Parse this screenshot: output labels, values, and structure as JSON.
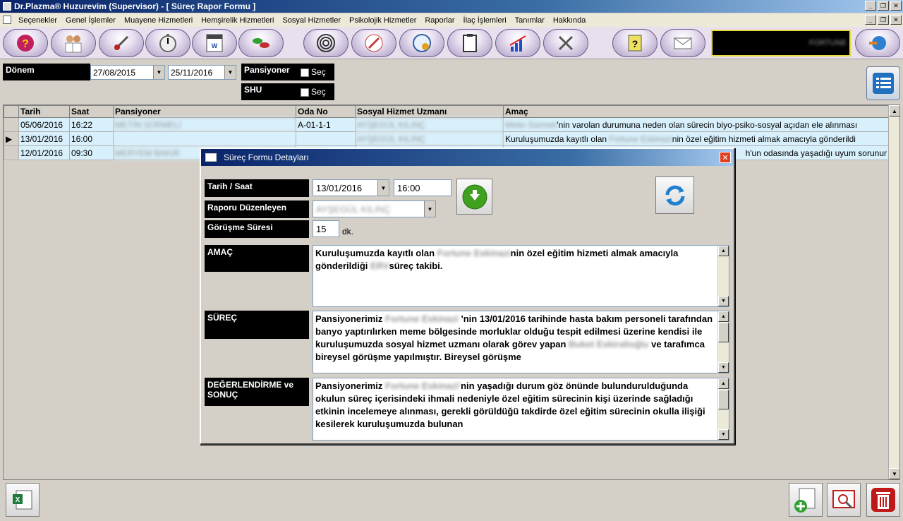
{
  "window": {
    "title": "Dr.Plazma® Huzurevim (Supervisor) - [ Süreç Rapor Formu ]"
  },
  "menu": [
    "Seçenekler",
    "Genel İşlemler",
    "Muayene Hizmetleri",
    "Hemşirelik Hizmetleri",
    "Sosyal Hizmetler",
    "Psikolojik Hizmetler",
    "Raporlar",
    "İlaç İşlemleri",
    "Tanımlar",
    "Hakkında"
  ],
  "toolbar": {
    "icons": [
      "head-help-icon",
      "doctors-icon",
      "nurse-tools-icon",
      "stopwatch-icon",
      "doc-word-icon",
      "pills-icon",
      "spiral-icon",
      "pen-icon",
      "clock-refresh-icon",
      "clipboard-icon",
      "chart-icon",
      "tools-icon",
      "help-note-icon",
      "mail-icon",
      "globe-icon"
    ],
    "brand": "FORTUNE"
  },
  "filters": {
    "period_label": "Dönem",
    "date_from": "27/08/2015",
    "date_to": "25/11/2016",
    "resident_label": "Pansiyoner",
    "resident_check": "Seç",
    "shu_label": "SHU",
    "shu_check": "Seç"
  },
  "grid": {
    "columns": [
      "Tarih",
      "Saat",
      "Pansiyoner",
      "Oda No",
      "Sosyal Hizmet Uzmanı",
      "Amaç"
    ],
    "rows": [
      {
        "date": "05/06/2016",
        "time": "16:22",
        "resident": "METİN SÜRMELİ",
        "room": "A-01-1-1",
        "expert": "AYŞEGÜL KILINÇ",
        "purpose_blur": "Metin Sürmeli",
        "purpose": "'nin varolan durumuna neden olan sürecin biyo-psiko-sosyal açıdan ele alınması"
      },
      {
        "date": "13/01/2016",
        "time": "16:00",
        "resident": "",
        "room": "",
        "expert": "AYŞEGÜL KILINÇ",
        "purpose_pre": "Kuruluşumuzda kayıtlı olan ",
        "purpose_blur": "Fortune Eskinazi",
        "purpose": "nin özel eğitim hizmeti almak amacıyla gönderildi"
      },
      {
        "date": "12/01/2016",
        "time": "09:30",
        "resident": "MERYEM BAKIR",
        "room": "",
        "expert": "",
        "purpose_blur": "",
        "purpose": "h'un odasında yaşadığı uyum sorunur"
      }
    ]
  },
  "dialog": {
    "title": "Süreç Formu Detayları",
    "date_time_label": "Tarih / Saat",
    "date": "13/01/2016",
    "time": "16:00",
    "author_label": "Raporu Düzenleyen",
    "author": "AYŞEGÜL KILINÇ",
    "duration_label": "Görüşme Süresi",
    "duration": "15",
    "duration_unit": "dk.",
    "purpose_label": "AMAÇ",
    "purpose_a": "Kuruluşumuzda kayıtlı olan ",
    "purpose_blur": "Fortune Eskinazi",
    "purpose_b": "nin özel eğitim hizmeti almak amacıyla gönderildiği ",
    "purpose_blur2": "ERV",
    "purpose_c": "süreç takibi.",
    "process_label": "SÜREÇ",
    "process_a": "Pansiyonerimiz ",
    "process_blur": "Fortune Eskinazi",
    "process_b": " 'nin 13/01/2016 tarihinde hasta bakım personeli tarafından banyo yaptırılırken meme bölgesinde morluklar olduğu tespit edilmesi üzerine kendisi ile kuruluşumuzda sosyal hizmet uzmanı olarak görev yapan ",
    "process_blur2": "Buket Eskiralioğlu",
    "process_c": " ve tarafımca bireysel görüşme yapılmıştır. Bireysel görüşme",
    "eval_label": "DEĞERLENDİRME ve SONUÇ",
    "eval_a": "Pansiyonerimiz ",
    "eval_blur": "Fortune Eskinazi'",
    "eval_b": "nin yaşadığı durum göz önünde bulundurulduğunda okulun süreç içerisindeki ihmali nedeniyle özel eğitim sürecinin kişi üzerinde sağladığı etkinin incelemeye alınması, gerekli görüldüğü takdirde özel eğitim sürecinin okulla ilişiği kesilerek kuruluşumuzda bulunan"
  }
}
